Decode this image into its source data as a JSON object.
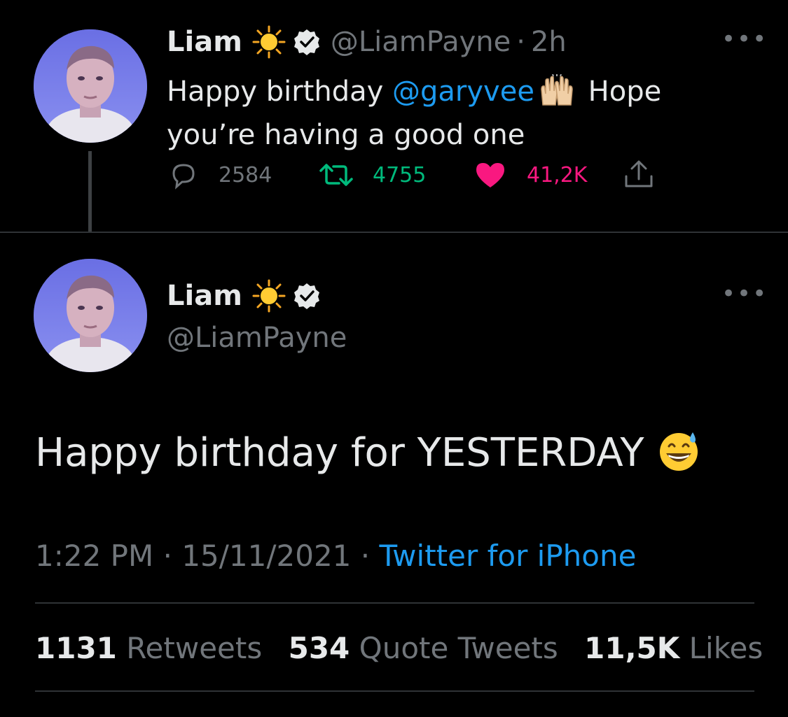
{
  "colors": {
    "background": "#000000",
    "text": "#e7e9ea",
    "muted": "#71767b",
    "link": "#1d9bf0",
    "retweet": "#00ba7c",
    "like": "#f91880",
    "divider": "#2f3336"
  },
  "reply_tweet": {
    "display_name": "Liam",
    "name_emoji": "sun-emoji",
    "verified_icon": "verified-badge-icon",
    "handle": "@LiamPayne",
    "separator": "·",
    "time": "2h",
    "text_part1": "Happy birthday ",
    "mention": "@garyvee",
    "inline_emoji": "raising-hands-emoji",
    "text_part2": " Hope you’re having a good one",
    "more_icon": "more-options-icon",
    "replies": "2584",
    "retweets": "4755",
    "likes": "41,2K",
    "liked": true
  },
  "main_tweet": {
    "display_name": "Liam",
    "name_emoji": "sun-emoji",
    "verified_icon": "verified-badge-icon",
    "handle": "@LiamPayne",
    "more_icon": "more-options-icon",
    "text": "Happy birthday for YESTERDAY ",
    "text_emoji": "grinning-sweat-emoji",
    "time": "1:22 PM",
    "separator": "·",
    "date": "15/11/2021",
    "source": "Twitter for iPhone",
    "stats": {
      "retweets_count": "1131",
      "retweets_label": "Retweets",
      "quotes_count": "534",
      "quotes_label": "Quote Tweets",
      "likes_count": "11,5K",
      "likes_label": "Likes"
    }
  }
}
